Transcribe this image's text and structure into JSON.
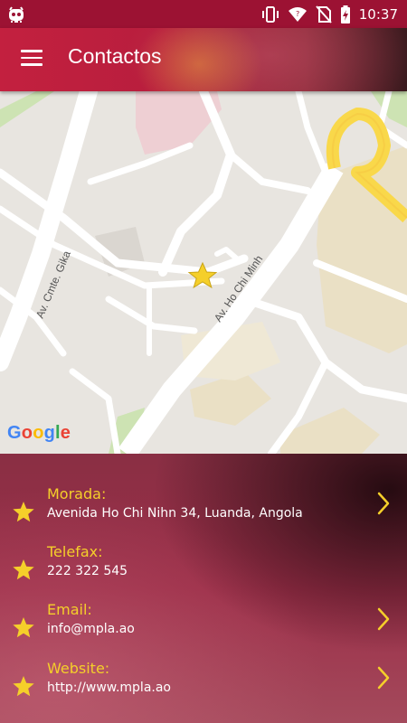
{
  "status_bar": {
    "time": "10:37",
    "icons": [
      "android-debug-icon",
      "vibrate-icon",
      "wifi-icon",
      "no-sim-icon",
      "battery-charging-icon"
    ]
  },
  "app_bar": {
    "title": "Contactos",
    "menu_icon": "hamburger-menu-icon"
  },
  "map": {
    "streets": [
      "Av. Cmte. Gika",
      "Av. Ho Chi Minh"
    ],
    "attribution": "Google",
    "marker_icon": "star-marker-icon",
    "colors": {
      "land": "#e8e5e0",
      "road": "#ffffff",
      "highway": "#f9d84a",
      "block": "#eae0c5",
      "park": "#cde3b3"
    }
  },
  "contacts": [
    {
      "label": "Morada:",
      "value": "Avenida Ho Chi Nihn 34, Luanda, Angola",
      "has_action": true
    },
    {
      "label": "Telefax:",
      "value": "222 322 545",
      "has_action": false
    },
    {
      "label": "Email:",
      "value": "info@mpla.ao",
      "has_action": true
    },
    {
      "label": "Website:",
      "value": "http://www.mpla.ao",
      "has_action": true
    }
  ],
  "colors": {
    "accent": "#f5cf2a",
    "primary": "#c3203f",
    "status_bar": "#9c1233"
  }
}
